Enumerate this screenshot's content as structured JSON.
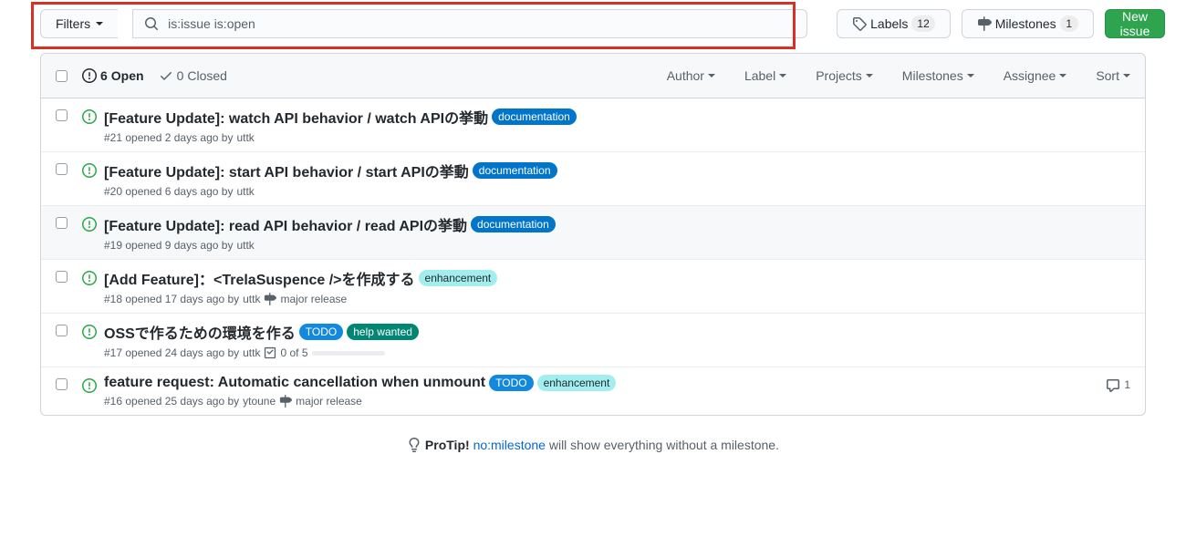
{
  "search": {
    "filters_label": "Filters",
    "query": "is:issue is:open"
  },
  "toolbar": {
    "labels_label": "Labels",
    "labels_count": "12",
    "milestones_label": "Milestones",
    "milestones_count": "1",
    "new_issue_label": "New issue"
  },
  "states": {
    "open_count": "6",
    "open_label": "Open",
    "closed_count": "0",
    "closed_label": "Closed"
  },
  "filters": {
    "author": "Author",
    "label": "Label",
    "projects": "Projects",
    "milestones": "Milestones",
    "assignee": "Assignee",
    "sort": "Sort"
  },
  "label_colors": {
    "documentation": {
      "bg": "#0075ca",
      "fg": "#ffffff"
    },
    "enhancement": {
      "bg": "#a2eeef",
      "fg": "#24292e"
    },
    "TODO": {
      "bg": "#1289de",
      "fg": "#ffffff"
    },
    "help wanted": {
      "bg": "#008672",
      "fg": "#ffffff"
    }
  },
  "issues": [
    {
      "title": "[Feature Update]: watch API behavior / watch APIの挙動",
      "labels": [
        "documentation"
      ],
      "number": "#21",
      "opened": "opened 2 days ago by",
      "author": "uttk",
      "milestone": null,
      "tasks": null,
      "comments": null,
      "faded": false
    },
    {
      "title": "[Feature Update]: start API behavior / start APIの挙動",
      "labels": [
        "documentation"
      ],
      "number": "#20",
      "opened": "opened 6 days ago by",
      "author": "uttk",
      "milestone": null,
      "tasks": null,
      "comments": null,
      "faded": false
    },
    {
      "title": "[Feature Update]: read API behavior / read APIの挙動",
      "labels": [
        "documentation"
      ],
      "number": "#19",
      "opened": "opened 9 days ago by",
      "author": "uttk",
      "milestone": null,
      "tasks": null,
      "comments": null,
      "faded": true
    },
    {
      "title": "[Add Feature]：<TrelaSuspence />を作成する",
      "labels": [
        "enhancement"
      ],
      "number": "#18",
      "opened": "opened 17 days ago by",
      "author": "uttk",
      "milestone": "major release",
      "tasks": null,
      "comments": null,
      "faded": false
    },
    {
      "title": "OSSで作るための環境を作る",
      "labels": [
        "TODO",
        "help wanted"
      ],
      "number": "#17",
      "opened": "opened 24 days ago by",
      "author": "uttk",
      "milestone": null,
      "tasks": "0 of 5",
      "comments": null,
      "faded": false
    },
    {
      "title": "feature request: Automatic cancellation when unmount",
      "labels": [
        "TODO",
        "enhancement"
      ],
      "number": "#16",
      "opened": "opened 25 days ago by",
      "author": "ytoune",
      "milestone": "major release",
      "tasks": null,
      "comments": "1",
      "faded": false
    }
  ],
  "protip": {
    "prefix": "ProTip!",
    "link": "no:milestone",
    "suffix": "will show everything without a milestone."
  }
}
